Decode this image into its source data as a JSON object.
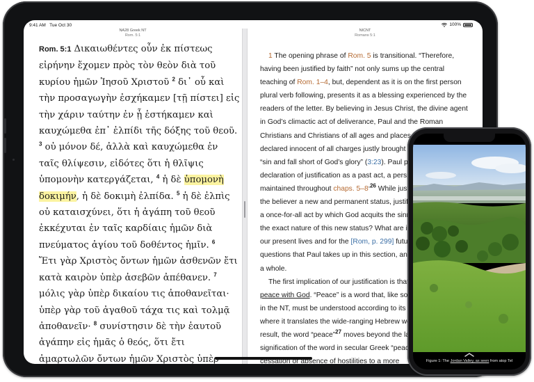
{
  "status": {
    "time": "9:41 AM",
    "date": "Tue Oct 30",
    "battery": "100%"
  },
  "left_pane": {
    "title": "NA28 Greek NT",
    "location": "Rom. 5:1",
    "reference": "Rom. 5:1",
    "lines": [
      {
        "segments": [
          {
            "t": "Δικαιωθέντες οὖν ἐκ πίστεως"
          }
        ]
      },
      {
        "segments": [
          {
            "t": "εἰρήνην ἔχομεν πρὸς τὸν θεὸν διὰ τοῦ"
          }
        ]
      },
      {
        "segments": [
          {
            "t": "κυρίου ἡμῶν Ἰησοῦ Χριστοῦ "
          },
          {
            "sup": "2"
          },
          {
            "t": " δι᾽ οὗ καὶ"
          }
        ]
      },
      {
        "segments": [
          {
            "t": "τὴν προσαγωγὴν ἐσχήκαμεν [τῇ πίστει] εἰς"
          }
        ]
      },
      {
        "segments": [
          {
            "t": "τὴν χάριν ταύτην ἐν ᾗ ἑστήκαμεν καὶ"
          }
        ]
      },
      {
        "segments": [
          {
            "t": "καυχώμεθα ἐπ᾽ ἐλπίδι τῆς δόξης τοῦ θεοῦ."
          }
        ]
      },
      {
        "segments": [
          {
            "sup": "3"
          },
          {
            "t": " οὐ μόνον δέ, ἀλλὰ καὶ καυχώμεθα ἐν"
          }
        ]
      },
      {
        "segments": [
          {
            "t": "ταῖς θλίψεσιν, εἰδότες ὅτι ἡ θλῖψις"
          }
        ]
      },
      {
        "segments": [
          {
            "t": "ὑπομονὴν κατεργάζεται, "
          },
          {
            "sup": "4"
          },
          {
            "t": " ἡ δὲ "
          },
          {
            "hl": "ὑπομονὴ"
          }
        ]
      },
      {
        "segments": [
          {
            "hl": "δοκιμήν"
          },
          {
            "t": ", ἡ δὲ δοκιμὴ ἐλπίδα. "
          },
          {
            "sup": "5"
          },
          {
            "t": " ἡ δὲ ἐλπὶς"
          }
        ]
      },
      {
        "segments": [
          {
            "t": "οὐ καταισχύνει, ὅτι ἡ ἀγάπη τοῦ θεοῦ"
          }
        ]
      },
      {
        "segments": [
          {
            "t": "ἐκκέχυται ἐν ταῖς καρδίαις ἡμῶν διὰ"
          }
        ]
      },
      {
        "segments": [
          {
            "t": "πνεύματος ἁγίου τοῦ δοθέντος ἡμῖν.    "
          },
          {
            "sup": "6"
          }
        ]
      },
      {
        "segments": [
          {
            "t": "Ἔτι γὰρ Χριστὸς ὄντων ἡμῶν ἀσθενῶν ἔτι"
          }
        ]
      },
      {
        "segments": [
          {
            "t": "κατὰ καιρὸν ὑπὲρ ἀσεβῶν ἀπέθανεν. "
          },
          {
            "sup": "7"
          }
        ]
      },
      {
        "segments": [
          {
            "t": "μόλις γὰρ ὑπὲρ δικαίου τις ἀποθανεῖται·"
          }
        ]
      },
      {
        "segments": [
          {
            "t": "ὑπὲρ γὰρ τοῦ ἀγαθοῦ τάχα τις καὶ τολμᾷ"
          }
        ]
      },
      {
        "segments": [
          {
            "t": "ἀποθανεῖν· "
          },
          {
            "sup": "8"
          },
          {
            "t": " συνίστησιν δὲ τὴν ἑαυτοῦ"
          }
        ]
      },
      {
        "segments": [
          {
            "t": "ἀγάπην εἰς ἡμᾶς ὁ θεός, ὅτι ἔτι"
          }
        ]
      },
      {
        "segments": [
          {
            "t": "ἁμαρτωλῶν ὄντων ἡμῶν Χριστὸς ὑπὲρ"
          }
        ]
      }
    ]
  },
  "right_pane": {
    "title": "NICNT",
    "location": "Romans  5:1",
    "lines": [
      {
        "indent": true,
        "segments": [
          {
            "num": "1"
          },
          {
            "t": " The opening phrase of "
          },
          {
            "brown": "Rom. 5"
          },
          {
            "t": " is transitional. “Therefore,"
          }
        ]
      },
      {
        "segments": [
          {
            "t": "having been justified by faith” not only sums up the central"
          }
        ]
      },
      {
        "segments": [
          {
            "t": "teaching of "
          },
          {
            "brown": "Rom. 1–4"
          },
          {
            "t": ", but, dependent as it is on the first person"
          }
        ]
      },
      {
        "segments": [
          {
            "t": "plural verb following, presents it as a blessing experienced by the"
          }
        ]
      },
      {
        "segments": [
          {
            "t": "readers of the letter. By believing in Jesus Christ, the divine agent"
          }
        ]
      },
      {
        "segments": [
          {
            "t": "in God’s climactic act of deliverance, Paul and the Roman"
          }
        ]
      },
      {
        "segments": [
          {
            "t": "Christians and Christians of all ages and places have been"
          }
        ]
      },
      {
        "segments": [
          {
            "t": "declared innocent of all charges justly brought against"
          }
        ]
      },
      {
        "segments": [
          {
            "t": "“sin and fall short of God’s glory” ("
          },
          {
            "blue": "3:23"
          },
          {
            "t": "). Paul presents"
          }
        ]
      },
      {
        "segments": [
          {
            "t": "declaration of justification as a past act, a perspective"
          }
        ]
      },
      {
        "segments": [
          {
            "t": "maintained throughout "
          },
          {
            "brown": "chaps. 5–8"
          },
          {
            "sup": ".26"
          },
          {
            "t": " While justification"
          }
        ]
      },
      {
        "segments": [
          {
            "t": "the believer a new and permanent status, justification"
          }
        ]
      },
      {
        "segments": [
          {
            "t": "a once-for-all act by which God acquits the sinner"
          }
        ]
      },
      {
        "segments": [
          {
            "t": "the exact nature of this new status? What are its"
          }
        ]
      },
      {
        "segments": [
          {
            "t": "our present lives and for the "
          },
          {
            "blue": "[Rom, p. 299]"
          },
          {
            "t": " future"
          }
        ]
      },
      {
        "segments": [
          {
            "t": "questions that Paul takes up in this section, and in"
          }
        ]
      },
      {
        "segments": [
          {
            "t": "a whole."
          }
        ]
      },
      {
        "indent": true,
        "segments": [
          {
            "t": "The first implication of our justification is that"
          }
        ]
      },
      {
        "segments": [
          {
            "u": "peace with God"
          },
          {
            "t": ". “Peace” is a word that, like so many"
          }
        ]
      },
      {
        "segments": [
          {
            "t": "in the NT, must be understood according to its usage"
          }
        ]
      },
      {
        "segments": [
          {
            "t": "where it translates the wide-ranging Hebrew word"
          }
        ]
      },
      {
        "segments": [
          {
            "t": "result, the word “peace”"
          },
          {
            "sup": "27"
          },
          {
            "t": " moves beyond the largely"
          }
        ]
      },
      {
        "segments": [
          {
            "t": "signification of the word in secular Greek “peace”"
          }
        ]
      },
      {
        "segments": [
          {
            "t": "cessation or absence of hostilities to a more"
          }
        ]
      }
    ]
  },
  "phone": {
    "caption_prefix": "Figure 1: The ",
    "caption_link": "Jordan Valley, as seen",
    "caption_suffix": " from atop Tel"
  },
  "colors": {
    "highlight": "#fbf3a0",
    "reference_brown": "#b56a32",
    "link_blue": "#3a6ea5"
  }
}
